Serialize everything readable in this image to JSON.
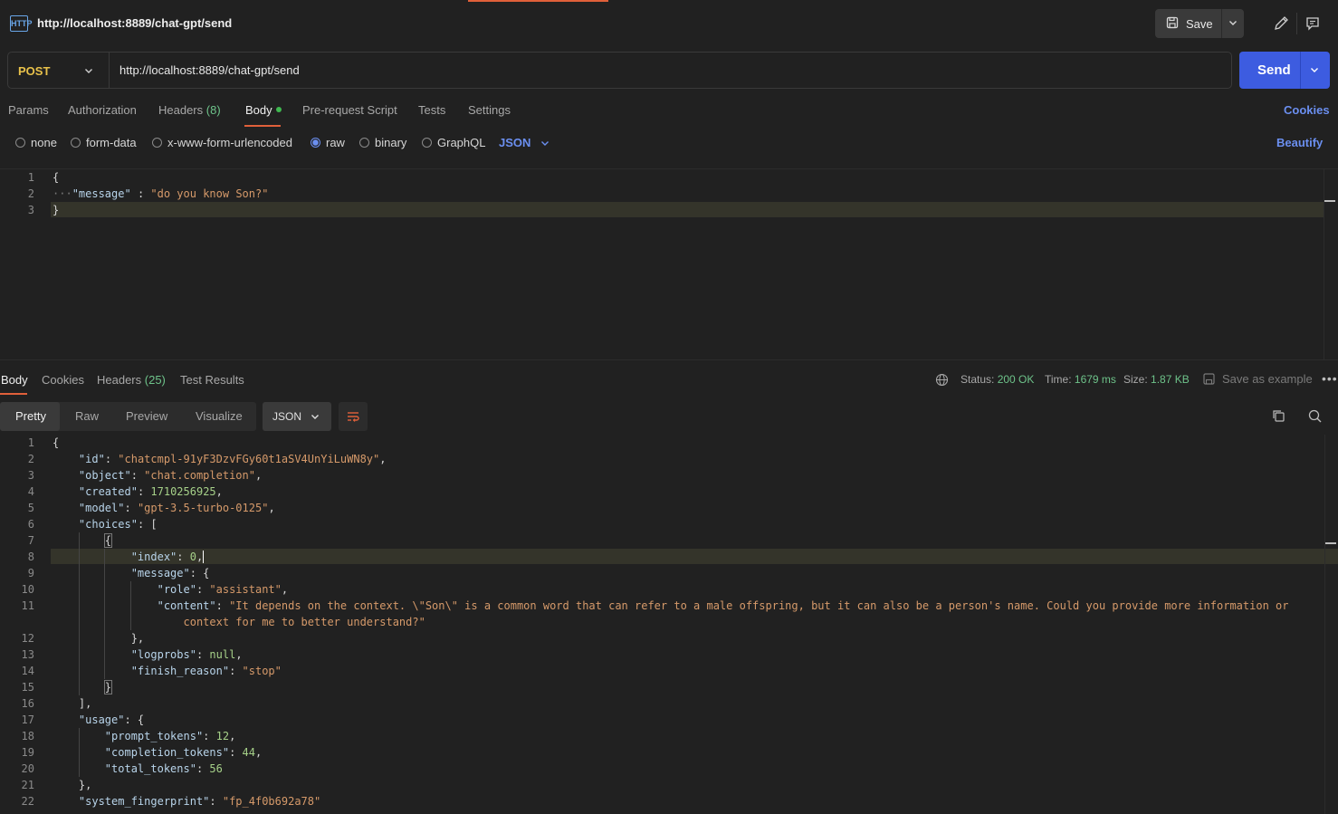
{
  "request": {
    "title": "http://localhost:8889/chat-gpt/send",
    "save_label": "Save",
    "method": "POST",
    "url": "http://localhost:8889/chat-gpt/send",
    "send_label": "Send"
  },
  "req_tabs": {
    "params": "Params",
    "authorization": "Authorization",
    "headers": "Headers",
    "headers_count": "(8)",
    "body": "Body",
    "prerequest": "Pre-request Script",
    "tests": "Tests",
    "settings": "Settings",
    "cookies": "Cookies"
  },
  "body_types": {
    "none": "none",
    "form_data": "form-data",
    "urlencoded": "x-www-form-urlencoded",
    "raw": "raw",
    "binary": "binary",
    "graphql": "GraphQL",
    "lang": "JSON",
    "beautify": "Beautify"
  },
  "request_body": {
    "line_numbers": [
      "1",
      "2",
      "3"
    ],
    "open": "{",
    "key": "\"message\"",
    "colon": " : ",
    "value": "\"do you know Son?\"",
    "close": "}"
  },
  "response_tabs": {
    "body": "Body",
    "cookies": "Cookies",
    "headers": "Headers",
    "headers_count": "(25)",
    "test_results": "Test Results"
  },
  "response_meta": {
    "status_label": "Status:",
    "status_value": "200 OK",
    "time_label": "Time:",
    "time_value": "1679 ms",
    "size_label": "Size:",
    "size_value": "1.87 KB",
    "save_example": "Save as example"
  },
  "view_modes": {
    "pretty": "Pretty",
    "raw": "Raw",
    "preview": "Preview",
    "visualize": "Visualize",
    "format": "JSON"
  },
  "response_body": {
    "line_numbers": [
      "1",
      "2",
      "3",
      "4",
      "5",
      "6",
      "7",
      "8",
      "9",
      "10",
      "11",
      "",
      "12",
      "13",
      "14",
      "15",
      "16",
      "17",
      "18",
      "19",
      "20",
      "21",
      "22"
    ],
    "id_key": "\"id\"",
    "id_val": "\"chatcmpl-91yF3DzvFGy60t1aSV4UnYiLuWN8y\"",
    "object_key": "\"object\"",
    "object_val": "\"chat.completion\"",
    "created_key": "\"created\"",
    "created_val": "1710256925",
    "model_key": "\"model\"",
    "model_val": "\"gpt-3.5-turbo-0125\"",
    "choices_key": "\"choices\"",
    "index_key": "\"index\"",
    "index_val": "0",
    "message_key": "\"message\"",
    "role_key": "\"role\"",
    "role_val": "\"assistant\"",
    "content_key": "\"content\"",
    "content_val_1": "\"It depends on the context. \\\"Son\\\" is a common word that can refer to a male offspring, but it can also be a person's name. Could you provide more information or",
    "content_val_2": "context for me to better understand?\"",
    "logprobs_key": "\"logprobs\"",
    "logprobs_val": "null",
    "finish_key": "\"finish_reason\"",
    "finish_val": "\"stop\"",
    "usage_key": "\"usage\"",
    "prompt_key": "\"prompt_tokens\"",
    "prompt_val": "12",
    "completion_key": "\"completion_tokens\"",
    "completion_val": "44",
    "total_key": "\"total_tokens\"",
    "total_val": "56",
    "fingerprint_key": "\"system_fingerprint\"",
    "fingerprint_val": "\"fp_4f0b692a78\""
  }
}
